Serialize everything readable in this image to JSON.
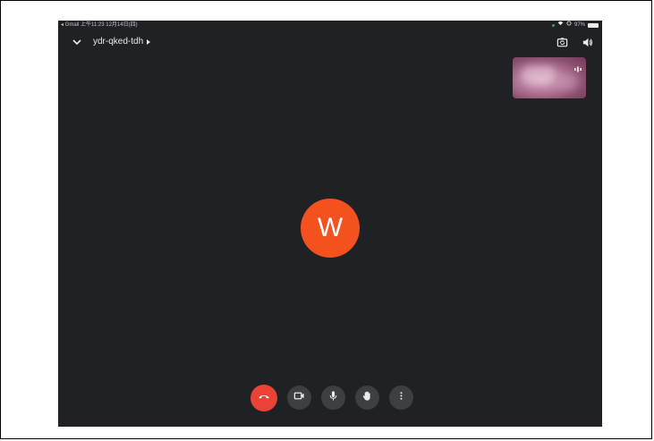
{
  "status_bar": {
    "left_text": "◂ Gmail  上午11:23  12月14日(四)",
    "battery": "97%"
  },
  "header": {
    "meeting_code": "ydr-qked-tdh"
  },
  "participant": {
    "initial": "W",
    "avatar_color": "#f4511e"
  },
  "colors": {
    "background": "#202124",
    "button": "#3c4043",
    "hangup": "#ea4335"
  },
  "icons": {
    "collapse": "chevron-down-icon",
    "switch_camera": "camera-switch-icon",
    "audio_output": "speaker-icon",
    "hangup": "phone-hangup-icon",
    "camera": "video-camera-icon",
    "mic": "microphone-icon",
    "raise_hand": "hand-icon",
    "more": "more-vertical-icon"
  }
}
